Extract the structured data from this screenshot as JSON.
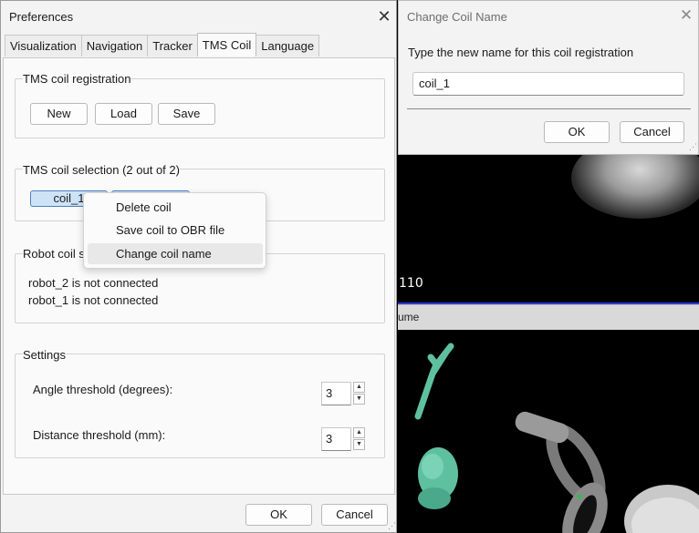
{
  "viewer": {
    "slice_number": "110",
    "volume_label": "ume"
  },
  "preferences": {
    "title": "Preferences",
    "tabs": [
      {
        "label": "Visualization"
      },
      {
        "label": "Navigation"
      },
      {
        "label": "Tracker"
      },
      {
        "label": "TMS Coil",
        "active": true
      },
      {
        "label": "Language"
      }
    ],
    "registration": {
      "title": "TMS coil registration",
      "new_label": "New",
      "load_label": "Load",
      "save_label": "Save"
    },
    "selection": {
      "title": "TMS coil selection (2 out of 2)",
      "coils": [
        "coil_1",
        ""
      ]
    },
    "robot": {
      "title": "Robot coil se",
      "lines": [
        "robot_2 is not connected",
        "robot_1 is not connected"
      ]
    },
    "settings": {
      "title": "Settings",
      "angle_label": "Angle threshold (degrees):",
      "angle_value": "3",
      "distance_label": "Distance threshold (mm):",
      "distance_value": "3"
    },
    "ok_label": "OK",
    "cancel_label": "Cancel"
  },
  "context_menu": {
    "items": [
      "Delete coil",
      "Save coil to OBR file",
      "Change coil name"
    ],
    "hovered": "Change coil name"
  },
  "rename_dialog": {
    "title": "Change Coil Name",
    "prompt": "Type the new name for this coil registration",
    "value": "coil_1",
    "ok_label": "OK",
    "cancel_label": "Cancel"
  },
  "colors": {
    "accent_border": "#4c7ebd",
    "selected_fill": "#cfe3f7",
    "viewer_divider": "#2a3bd6",
    "head_model": "#5fc0a0"
  }
}
